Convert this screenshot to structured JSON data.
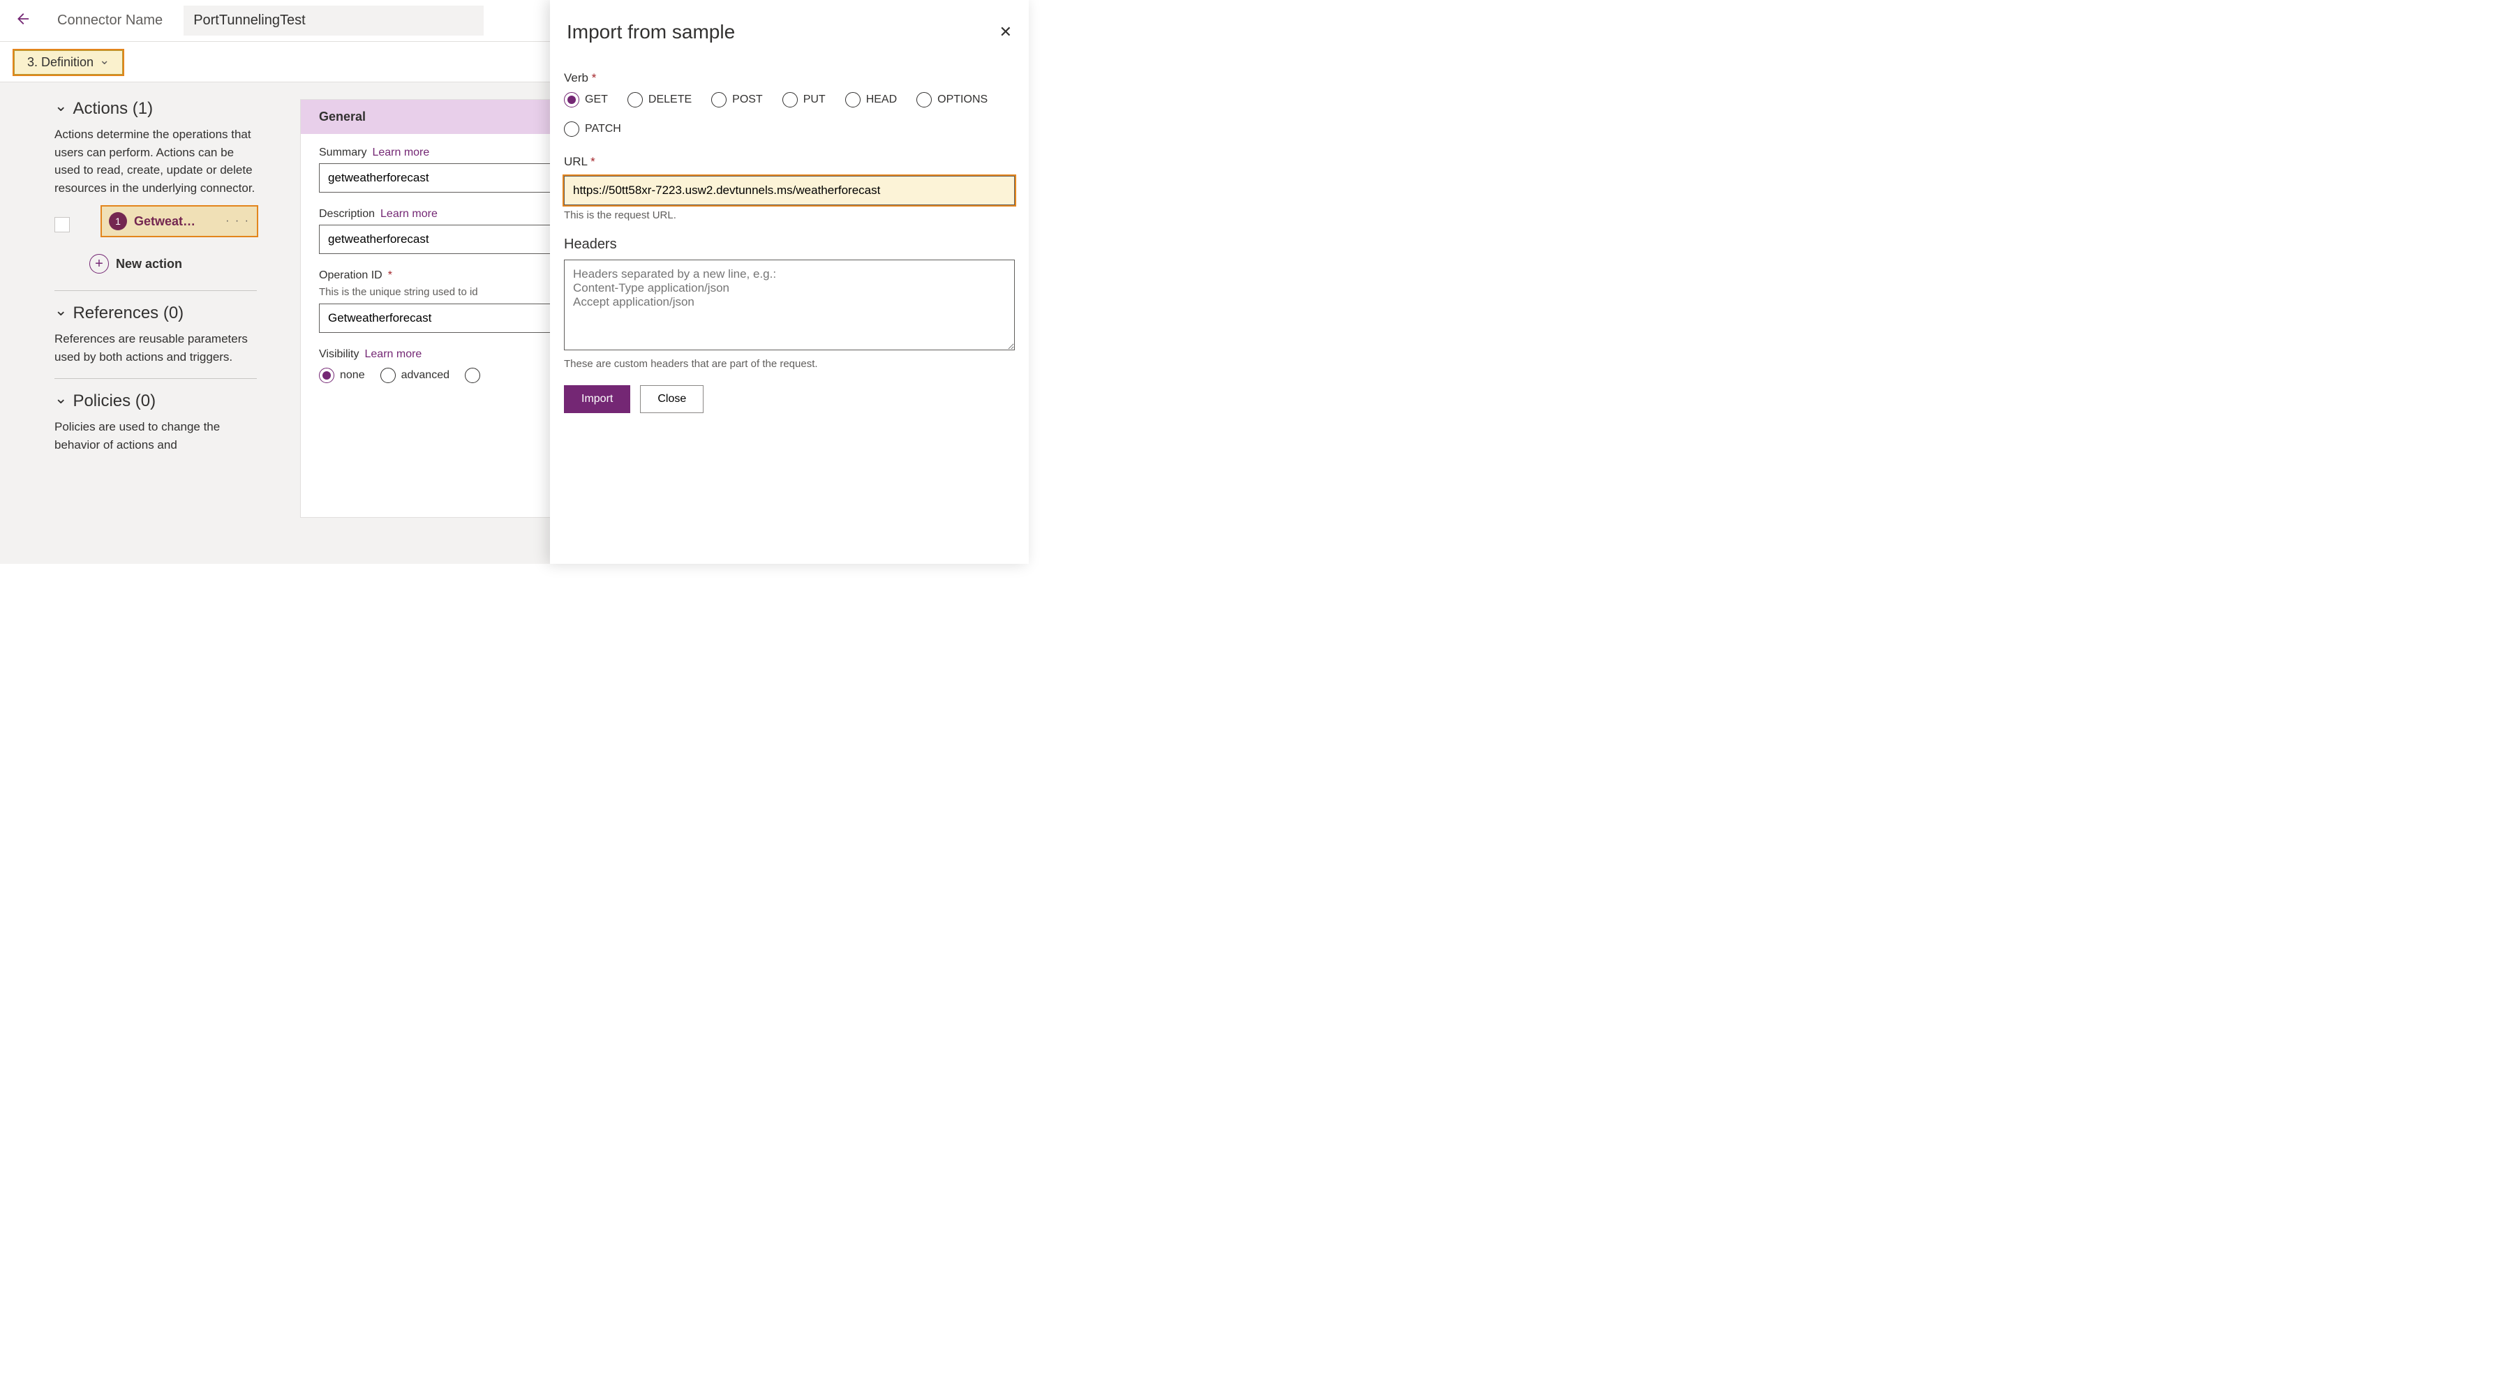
{
  "topbar": {
    "label": "Connector Name",
    "value": "PortTunnelingTest"
  },
  "step": {
    "label": "3. Definition"
  },
  "sections": {
    "actions": {
      "title": "Actions (1)",
      "desc": "Actions determine the operations that users can perform. Actions can be used to read, create, update or delete resources in the underlying connector.",
      "item_num": "1",
      "item_label": "Getweat…",
      "new_label": "New action"
    },
    "references": {
      "title": "References (0)",
      "desc": "References are reusable parameters used by both actions and triggers."
    },
    "policies": {
      "title": "Policies (0)",
      "desc": "Policies are used to change the behavior of actions and"
    }
  },
  "general": {
    "header": "General",
    "summary_label": "Summary",
    "learn_more": "Learn more",
    "summary_value": "getweatherforecast",
    "description_label": "Description",
    "description_value": "getweatherforecast",
    "operation_label": "Operation ID",
    "operation_help": "This is the unique string used to id",
    "operation_value": "Getweatherforecast",
    "visibility_label": "Visibility",
    "visibility_options": [
      "none",
      "advanced"
    ]
  },
  "panel": {
    "title": "Import from sample",
    "verb_label": "Verb",
    "verbs": [
      "GET",
      "DELETE",
      "POST",
      "PUT",
      "HEAD",
      "OPTIONS",
      "PATCH"
    ],
    "verb_selected": "GET",
    "url_label": "URL",
    "url_value": "https://50tt58xr-7223.usw2.devtunnels.ms/weatherforecast",
    "url_help": "This is the request URL.",
    "headers_label": "Headers",
    "headers_placeholder": "Headers separated by a new line, e.g.:\nContent-Type application/json\nAccept application/json",
    "headers_help": "These are custom headers that are part of the request.",
    "import_btn": "Import",
    "close_btn": "Close"
  }
}
